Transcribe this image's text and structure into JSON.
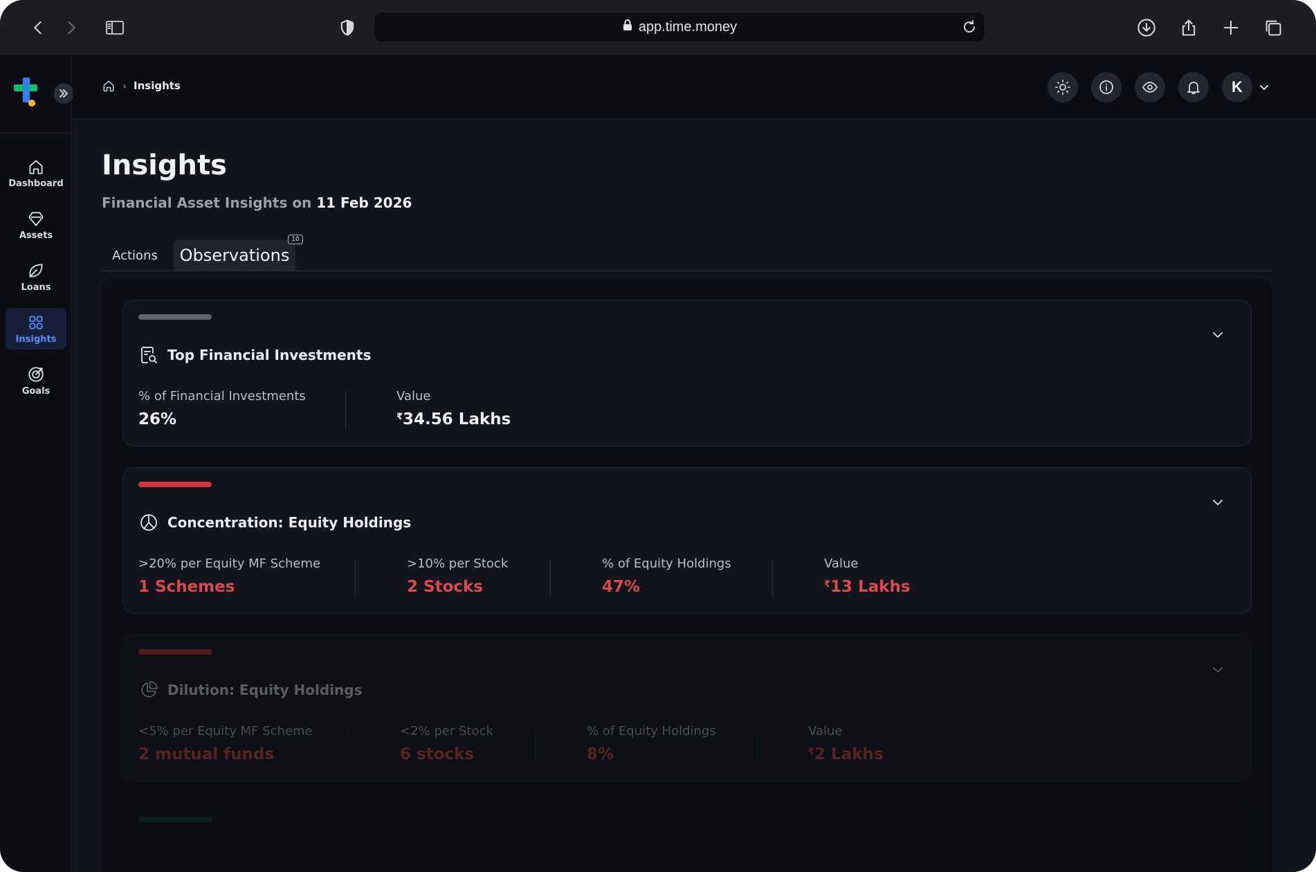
{
  "browser": {
    "url": "app.time.money"
  },
  "sidebar": {
    "items": [
      {
        "label": "Dashboard",
        "icon": "home-icon"
      },
      {
        "label": "Assets",
        "icon": "diamond-icon"
      },
      {
        "label": "Loans",
        "icon": "leaf-icon"
      },
      {
        "label": "Insights",
        "icon": "grid-icon",
        "active": true
      },
      {
        "label": "Goals",
        "icon": "target-icon"
      }
    ]
  },
  "header": {
    "breadcrumb_current": "Insights",
    "avatar_initial": "K"
  },
  "page": {
    "title": "Insights",
    "subtitle_prefix": "Financial Asset Insights on",
    "subtitle_date": "11 Feb 2026"
  },
  "tabs": {
    "actions_label": "Actions",
    "observations_label": "Observations",
    "observations_badge": "10"
  },
  "colors": {
    "neutral_bar": "#5f636c",
    "danger_bar": "#d2363c",
    "danger_text": "#d84a4f",
    "active_nav": "#5d8df5"
  },
  "cards": [
    {
      "title": "Top Financial Investments",
      "icon": "document-search-icon",
      "bar": "neutral",
      "metrics": [
        {
          "label": "% of Financial Investments",
          "value": "26%",
          "tone": "normal"
        },
        {
          "label": "Value",
          "currency": "₹",
          "value": "34.56 Lakhs",
          "tone": "normal"
        }
      ]
    },
    {
      "title": "Concentration: Equity Holdings",
      "icon": "pie-chart-icon",
      "bar": "danger",
      "metrics": [
        {
          "label": ">20% per Equity MF Scheme",
          "value": "1 Schemes",
          "tone": "danger"
        },
        {
          "label": ">10% per Stock",
          "value": "2 Stocks",
          "tone": "danger"
        },
        {
          "label": "% of Equity Holdings",
          "value": "47%",
          "tone": "danger"
        },
        {
          "label": "Value",
          "currency": "₹",
          "value": "13 Lakhs",
          "tone": "danger"
        }
      ]
    },
    {
      "title": "Dilution: Equity Holdings",
      "icon": "pie-split-icon",
      "bar": "danger",
      "metrics": [
        {
          "label": "<5% per Equity MF Scheme",
          "value": "2 mutual funds",
          "tone": "danger"
        },
        {
          "label": "<2% per Stock",
          "value": "6 stocks",
          "tone": "danger"
        },
        {
          "label": "% of Equity Holdings",
          "value": "8%",
          "tone": "danger"
        },
        {
          "label": "Value",
          "currency": "₹",
          "value": "2 Lakhs",
          "tone": "danger"
        }
      ]
    }
  ]
}
